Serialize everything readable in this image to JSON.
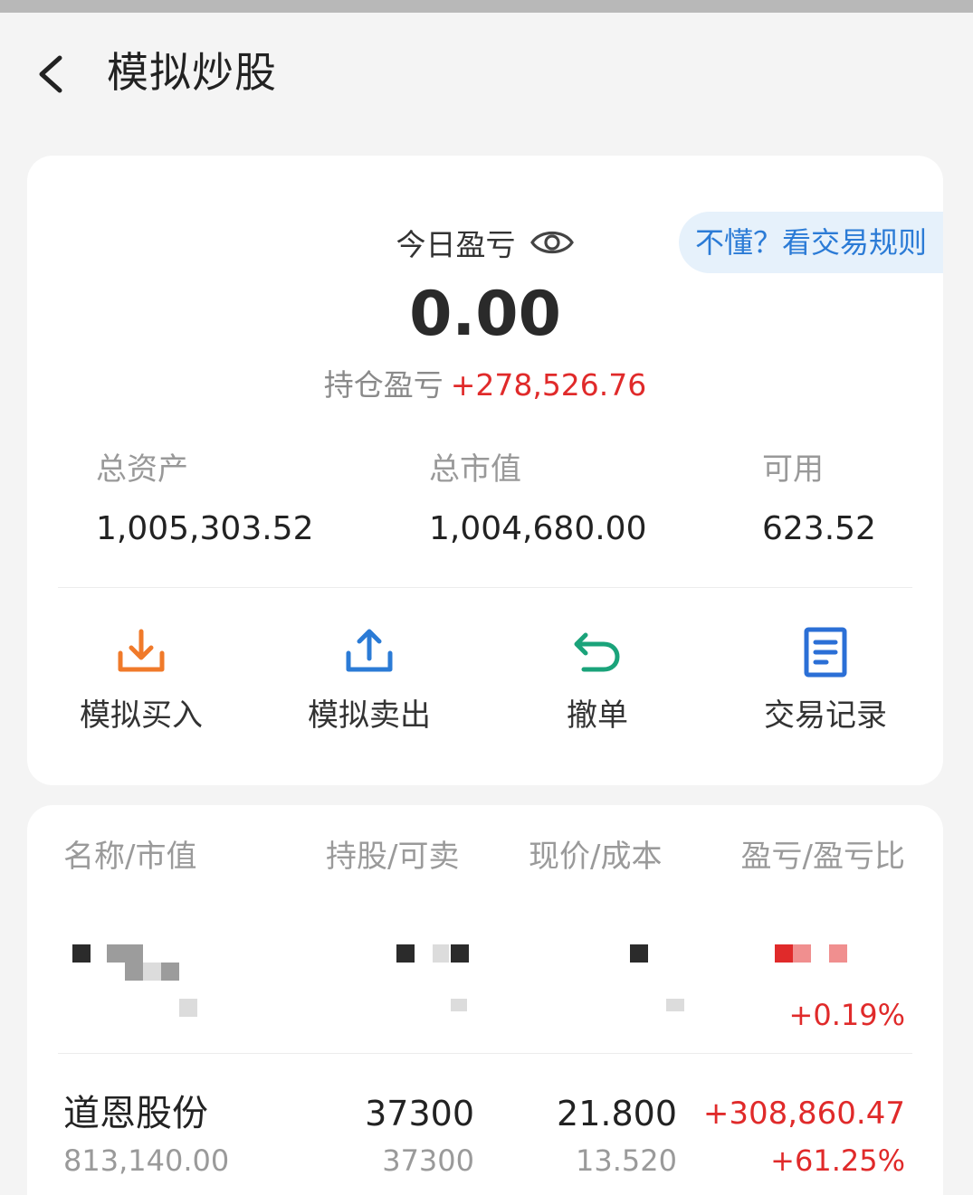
{
  "header": {
    "title": "模拟炒股",
    "back_icon": "chevron-left-icon"
  },
  "summary": {
    "rules_link": "不懂？看交易规则",
    "today_pnl_label": "今日盈亏",
    "eye_icon": "eye-icon",
    "today_pnl_value": "0.00",
    "holding_pnl_label": "持仓盈亏",
    "holding_pnl_value": "+278,526.76",
    "metrics": [
      {
        "label": "总资产",
        "value": "1,005,303.52"
      },
      {
        "label": "总市值",
        "value": "1,004,680.00"
      },
      {
        "label": "可用",
        "value": "623.52"
      }
    ]
  },
  "actions": [
    {
      "label": "模拟买入",
      "icon": "download-tray-icon",
      "color": "#f07a2a"
    },
    {
      "label": "模拟卖出",
      "icon": "upload-tray-icon",
      "color": "#2b7bd6"
    },
    {
      "label": "撤单",
      "icon": "undo-arrow-icon",
      "color": "#1aa37a"
    },
    {
      "label": "交易记录",
      "icon": "document-list-icon",
      "color": "#2b6fd6"
    }
  ],
  "holdings": {
    "columns": [
      "名称/市值",
      "持股/可卖",
      "现价/成本",
      "盈亏/盈亏比"
    ],
    "obscured_row": {
      "pnl_ratio": "+0.19%"
    },
    "rows": [
      {
        "name": "道恩股份",
        "market_value": "813,140.00",
        "shares": "37300",
        "sellable": "37300",
        "price": "21.800",
        "cost": "13.520",
        "pnl": "+308,860.47",
        "pnl_ratio": "+61.25%"
      }
    ]
  },
  "colors": {
    "gain": "#e02a2a",
    "link": "#2b7bd6",
    "link_bg": "#e6f1fb",
    "background": "#f4f4f4"
  }
}
